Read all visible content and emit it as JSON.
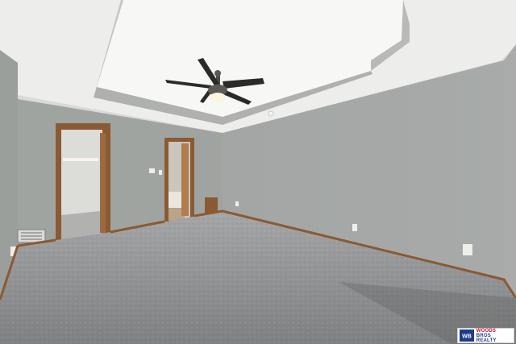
{
  "photo": {
    "subject": "empty-bedroom-with-tray-ceiling",
    "colors": {
      "wall_left": "#9ea29f",
      "wall_right": "#a5a8a7",
      "wall_far": "#a1a5a3",
      "ceiling": "#f1f1ef",
      "tray_ceiling": "#f7f7f5",
      "tray_band": "#b3b6b3",
      "carpet": "#8e8f90",
      "trim_wood": "#8a5a33",
      "fan_blade": "#2c2a29"
    }
  },
  "watermark": {
    "line1": "WOODS",
    "line2": "BROS REALTY",
    "monogram": "WB"
  }
}
